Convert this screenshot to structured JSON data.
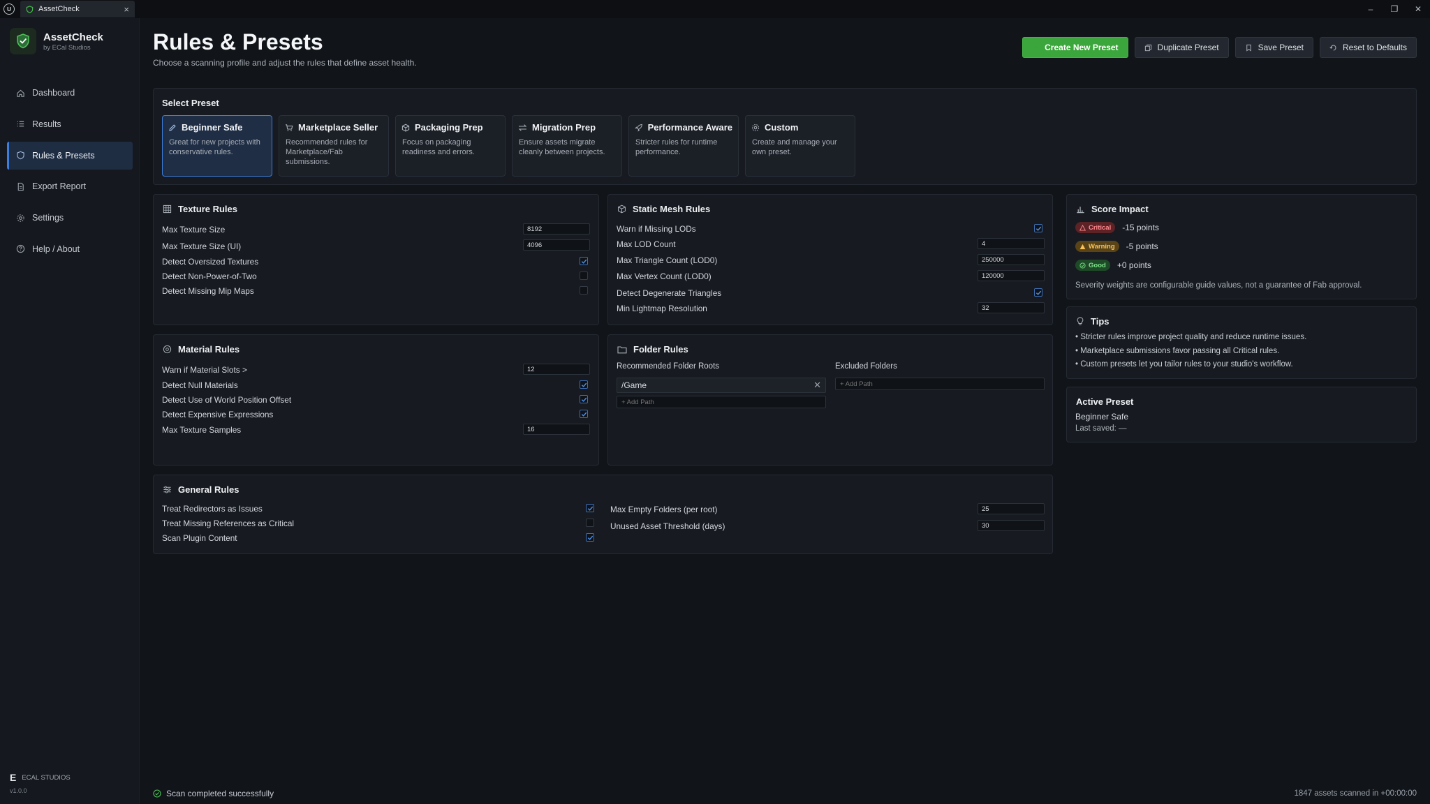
{
  "window": {
    "ue_logo": "U",
    "tab_title": "AssetCheck",
    "tab_close": "×",
    "controls": {
      "minimize": "–",
      "maximize": "❐",
      "close": "✕"
    }
  },
  "sidebar": {
    "app_name": "AssetCheck",
    "app_sub": "by ECal Studios",
    "items": [
      {
        "label": "Dashboard",
        "icon": "home-icon"
      },
      {
        "label": "Results",
        "icon": "list-icon"
      },
      {
        "label": "Rules & Presets",
        "icon": "shield-icon",
        "active": true
      },
      {
        "label": "Export Report",
        "icon": "document-icon"
      },
      {
        "label": "Settings",
        "icon": "gear-icon"
      },
      {
        "label": "Help / About",
        "icon": "help-icon"
      }
    ],
    "footer_mark": "E",
    "footer_brand": "ECAL STUDIOS",
    "version": "v1.0.0"
  },
  "header": {
    "title": "Rules & Presets",
    "subtitle": "Choose a scanning profile and adjust the rules that define asset health.",
    "buttons": {
      "create": "Create New Preset",
      "duplicate": "Duplicate Preset",
      "save": "Save Preset",
      "reset": "Reset to Defaults"
    }
  },
  "presets": {
    "label": "Select Preset",
    "items": [
      {
        "name": "Beginner Safe",
        "desc": "Great for new projects with conservative rules.",
        "active": true
      },
      {
        "name": "Marketplace Seller",
        "desc": "Recommended rules for Marketplace/Fab submissions."
      },
      {
        "name": "Packaging Prep",
        "desc": "Focus on packaging readiness and errors."
      },
      {
        "name": "Migration Prep",
        "desc": "Ensure assets migrate cleanly between projects."
      },
      {
        "name": "Performance Aware",
        "desc": "Stricter rules for runtime performance."
      },
      {
        "name": "Custom",
        "desc": "Create and manage your own preset."
      }
    ]
  },
  "texture": {
    "title": "Texture Rules",
    "max_size_label": "Max Texture Size",
    "max_size": "8192",
    "max_size_ui_label": "Max Texture Size (UI)",
    "max_size_ui": "4096",
    "oversized_label": "Detect Oversized Textures",
    "oversized": true,
    "npot_label": "Detect Non-Power-of-Two",
    "npot": false,
    "mips_label": "Detect Missing Mip Maps",
    "mips": false
  },
  "static_mesh": {
    "title": "Static Mesh Rules",
    "lods_label": "Warn if Missing LODs",
    "lods": true,
    "max_lod_label": "Max LOD Count",
    "max_lod": "4",
    "tri_label": "Max Triangle Count (LOD0)",
    "tri": "250000",
    "vert_label": "Max Vertex Count (LOD0)",
    "vert": "120000",
    "degenerate_label": "Detect Degenerate Triangles",
    "degenerate": true,
    "lightmap_label": "Min Lightmap Resolution",
    "lightmap": "32"
  },
  "material": {
    "title": "Material Rules",
    "slots_label": "Warn if Material Slots >",
    "slots": "12",
    "null_label": "Detect Null Materials",
    "null": true,
    "wpo_label": "Detect Use of World Position Offset",
    "wpo": true,
    "expensive_label": "Detect Expensive Expressions",
    "expensive": true,
    "samples_label": "Max Texture Samples",
    "samples": "16"
  },
  "folder": {
    "title": "Folder Rules",
    "roots_label": "Recommended Folder Roots",
    "excluded_label": "Excluded Folders",
    "root_path": "/Game",
    "add_path_placeholder": "+ Add Path"
  },
  "general": {
    "title": "General Rules",
    "redirectors_label": "Treat Redirectors as Issues",
    "redirectors": true,
    "missing_refs_label": "Treat Missing References as Critical",
    "missing_refs": false,
    "plugin_label": "Scan Plugin Content",
    "plugin": true,
    "empty_folders_label": "Max Empty Folders (per root)",
    "empty_folders": "25",
    "unused_label": "Unused Asset Threshold (days)",
    "unused": "30"
  },
  "score_impact": {
    "title": "Score Impact",
    "rows": [
      {
        "badge": "Critical",
        "points": "-15 points",
        "color": "#ff8a8f"
      },
      {
        "badge": "Warning",
        "points": "-5 points",
        "color": "#f7c35a"
      },
      {
        "badge": "Good",
        "points": "+0 points",
        "color": "#7ee28b"
      }
    ],
    "note": "Severity weights are configurable guide values, not a guarantee of Fab approval."
  },
  "tips": {
    "title": "Tips",
    "items": [
      "• Stricter rules improve project quality and reduce runtime issues.",
      "• Marketplace submissions favor passing all Critical rules.",
      "• Custom presets let you tailor rules to your studio's workflow."
    ]
  },
  "active_preset": {
    "title": "Active Preset",
    "name": "Beginner Safe",
    "last_saved": "Last saved: —"
  },
  "status": {
    "message": "Scan completed successfully",
    "summary": "1847 assets scanned in +00:00:00"
  },
  "colors": {
    "accent_green": "#3ba63b",
    "accent_blue": "#3d7ddb",
    "background": "#111419"
  }
}
